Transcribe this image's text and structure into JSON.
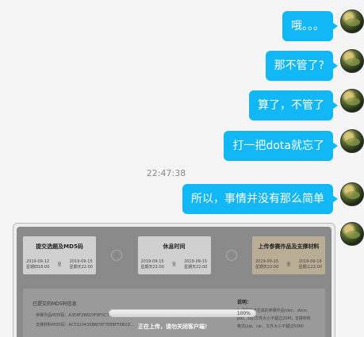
{
  "messages": [
    {
      "text": "哦。。。"
    },
    {
      "text": "那不管了?"
    },
    {
      "text": "算了，不管了"
    },
    {
      "text": "打一把dota就忘了"
    },
    {
      "text": "所以，事情并没有那么简单"
    }
  ],
  "timestamp": "22:47:38",
  "screenshot": {
    "steps": [
      {
        "title": "提交选题及MD5码",
        "start": "2019-09-12",
        "start_note": "星期四18:00",
        "sep": "至",
        "end": "2019-09-15",
        "end_note": "星期天22:00"
      },
      {
        "title": "休息时间",
        "start": "2019-09-15",
        "start_note": "星期天22:00",
        "sep": "至",
        "end": "2019-09-15",
        "end_note": "星期天22:00"
      },
      {
        "title": "上传参赛作品及支撑材料",
        "start": "2019-09-15",
        "start_note": "星期天22:00",
        "sep": "至",
        "end": "2019-09-18",
        "end_note": "星期三22:00"
      }
    ],
    "info_title": "已提交的MD5码信息",
    "info_lines": [
      "参赛作品MD5码：A3E4F2B6D3F8F5C7E4A3B6D5E9A0C1E8",
      "支撑材料MD5码：AC5320435B6D5F7E8BFF6B2D..."
    ],
    "side_title": "说明：",
    "side_lines": [
      "1.请提交已生成的参赛作品(doc、docx、",
      "pdf、zip)文件大小不超过20M；支撑材料",
      "格式(zip、rar，文件大小不超过50M)"
    ],
    "progress": {
      "value": 1.0,
      "label": "100%"
    },
    "upload_text": "正在上传，请勿关闭客户端！"
  },
  "colors": {
    "bubble": "#12b7f5",
    "background": "#f5f5f5"
  }
}
